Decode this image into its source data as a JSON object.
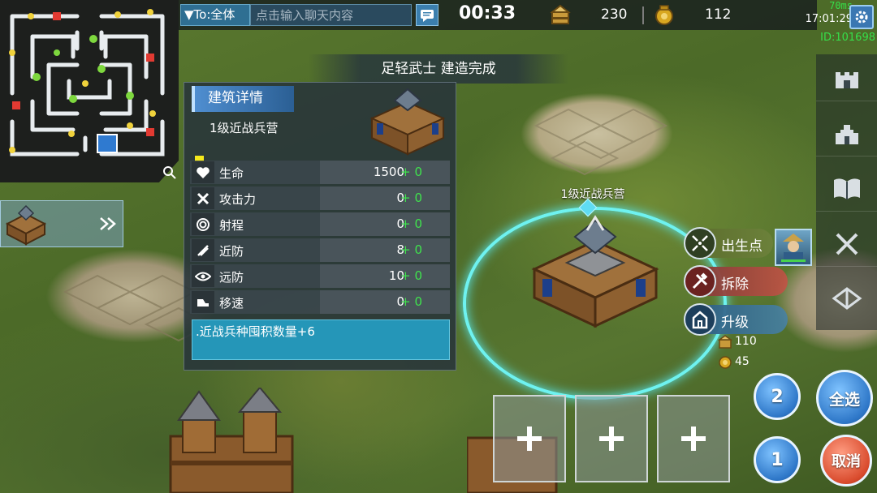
{
  "chat": {
    "target_label": "▼To:全体",
    "placeholder": "点击输入聊天内容"
  },
  "timer": "00:33",
  "resources": {
    "wood": {
      "icon": "resource-crate-icon",
      "value": "230"
    },
    "gold": {
      "icon": "gold-pouch-icon",
      "value": "112"
    }
  },
  "status": {
    "latency": "70ms",
    "clock": "17:01:29",
    "player_id": "ID:101698"
  },
  "notification": "足轻武士 建造完成",
  "building": {
    "world_label": "1级近战兵营"
  },
  "detail_panel": {
    "title": "建筑详情",
    "name": "1级近战兵营",
    "stats": [
      {
        "icon": "heart-icon",
        "label": "生命",
        "value": "1500",
        "bonus": "+ 0"
      },
      {
        "icon": "crossed-swords-icon",
        "label": "攻击力",
        "value": "0",
        "bonus": "+ 0"
      },
      {
        "icon": "target-icon",
        "label": "射程",
        "value": "0",
        "bonus": "+ 0"
      },
      {
        "icon": "melee-defense-icon",
        "label": "近防",
        "value": "8",
        "bonus": "+ 0"
      },
      {
        "icon": "eye-icon",
        "label": "远防",
        "value": "10",
        "bonus": "+ 0"
      },
      {
        "icon": "boot-icon",
        "label": "移速",
        "value": "0",
        "bonus": "+ 0"
      }
    ],
    "description": ".近战兵种囤积数量+6"
  },
  "actions": {
    "spawn": "出生点",
    "demolish": "拆除",
    "upgrade": "升级",
    "upgrade_cost_wood": "110",
    "upgrade_cost_gold": "45"
  },
  "side_menu": [
    "wall-icon",
    "castle-icon",
    "book-icon",
    "swords-icon",
    "crossbow-icon"
  ],
  "slots": [
    "+",
    "+",
    "+"
  ],
  "buttons": {
    "group_2": "2",
    "select_all": "全选",
    "group_1": "1",
    "cancel": "取消"
  },
  "colors": {
    "bonus_green": "#3fe24d",
    "ring_cyan": "#6ef2f0",
    "id_green": "#35e04a",
    "desc_blue": "#2596b8"
  }
}
